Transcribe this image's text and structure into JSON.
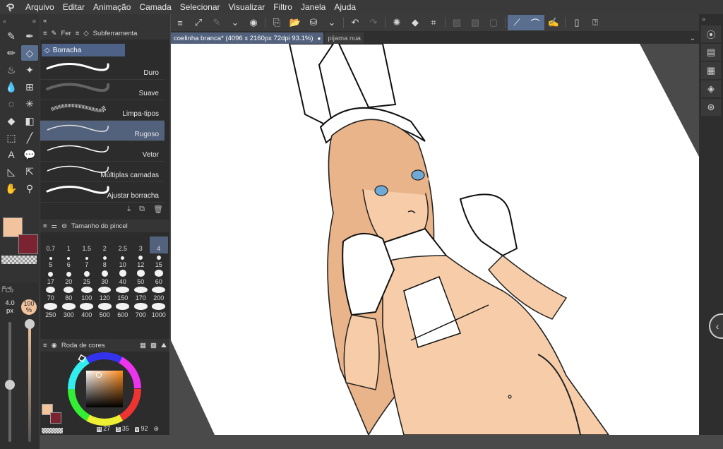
{
  "menu": {
    "items": [
      "Arquivo",
      "Editar",
      "Animação",
      "Camada",
      "Selecionar",
      "Visualizar",
      "Filtro",
      "Janela",
      "Ajuda"
    ]
  },
  "tools_panel": {
    "collapsed_tab_label": "Fer"
  },
  "subtool": {
    "panel_title": "Subferramenta",
    "group": "Borracha",
    "brushes": [
      {
        "name": "Duro",
        "selected": false
      },
      {
        "name": "Suave",
        "selected": false
      },
      {
        "name": "Limpa-tipos",
        "selected": false
      },
      {
        "name": "Rugoso",
        "selected": true
      },
      {
        "name": "Vetor",
        "selected": false
      },
      {
        "name": "Múltiplas camadas",
        "selected": false
      },
      {
        "name": "Ajustar borracha",
        "selected": false
      }
    ]
  },
  "brush_size_panel": {
    "title": "Tamanho do pincel",
    "sizes": [
      "0.7",
      "1",
      "1.5",
      "2",
      "2.5",
      "3",
      "4",
      "5",
      "6",
      "7",
      "8",
      "10",
      "12",
      "15",
      "17",
      "20",
      "25",
      "30",
      "40",
      "50",
      "60",
      "70",
      "80",
      "100",
      "120",
      "150",
      "170",
      "200",
      "250",
      "300",
      "400",
      "500",
      "600",
      "700",
      "1000"
    ],
    "selected": "4"
  },
  "size_opacity": {
    "label_prefix": "Co",
    "size": "4.0",
    "size_unit": "px",
    "opacity": "100",
    "opacity_unit": "%"
  },
  "color_wheel": {
    "title": "Roda de cores",
    "h_label": "H",
    "h": "27",
    "s_label": "S",
    "s": "35",
    "v_label": "V",
    "v": "92"
  },
  "colors": {
    "main": "#f2c49d",
    "sub": "#7b2330",
    "accent": "#52617c"
  },
  "tabs": [
    {
      "label": "coelinha branca* (4096 x 2160px 72dpi 93.1%)",
      "active": true
    },
    {
      "label": "pijama nua",
      "active": false
    }
  ],
  "icons": {
    "app": "clip-studio-logo-icon",
    "toolbar": [
      "menu-icon",
      "fit-icon",
      "quick-access-icon",
      "chevron-down-icon",
      "eye-icon",
      "new-file-icon",
      "open-folder-icon",
      "save-icon",
      "chevron-down-icon",
      "undo-icon",
      "redo-icon",
      "loading-icon",
      "fill-icon",
      "transform-icon",
      "layer-mask-icon",
      "mask-icon",
      "selection-icon",
      "stabilizer-icon",
      "line-icon",
      "pen-icon",
      "phone-icon",
      "help-icon"
    ]
  }
}
